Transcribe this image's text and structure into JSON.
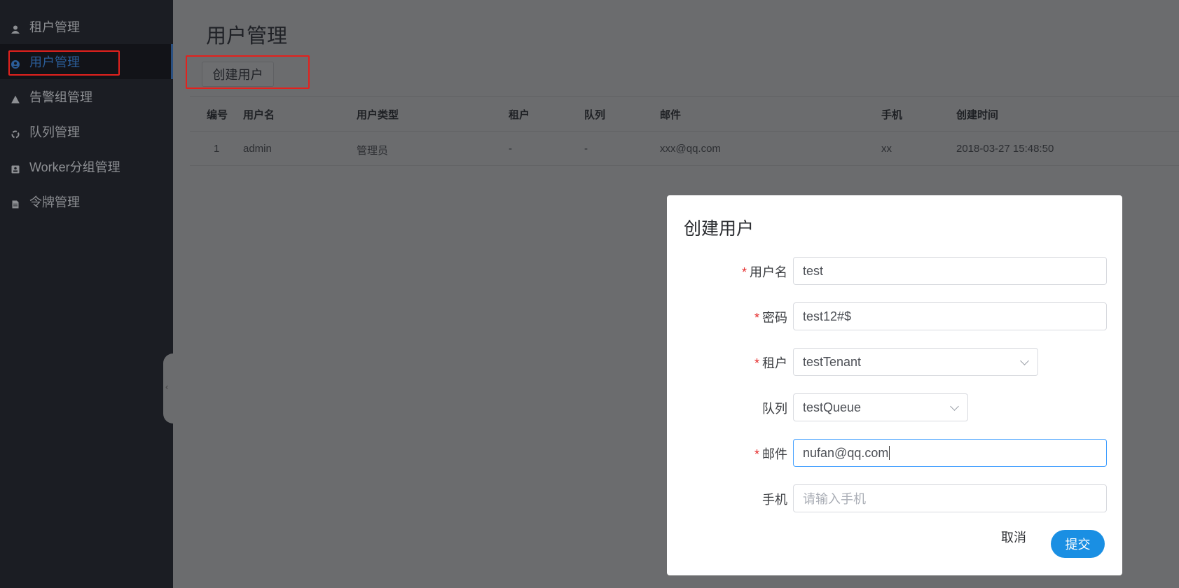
{
  "sidebar": {
    "items": [
      {
        "label": "租户管理",
        "icon": "user-icon"
      },
      {
        "label": "用户管理",
        "icon": "user-circle-icon",
        "active": true
      },
      {
        "label": "告警组管理",
        "icon": "warning-icon"
      },
      {
        "label": "队列管理",
        "icon": "recycle-icon"
      },
      {
        "label": "Worker分组管理",
        "icon": "id-card-icon"
      },
      {
        "label": "令牌管理",
        "icon": "document-icon"
      }
    ]
  },
  "main": {
    "title": "用户管理",
    "create_button": "创建用户",
    "table": {
      "headers": [
        "编号",
        "用户名",
        "用户类型",
        "租户",
        "队列",
        "邮件",
        "手机",
        "创建时间"
      ],
      "rows": [
        [
          "1",
          "admin",
          "管理员",
          "-",
          "-",
          "xxx@qq.com",
          "xx",
          "2018-03-27 15:48:50"
        ]
      ]
    }
  },
  "modal": {
    "title": "创建用户",
    "fields": {
      "username": {
        "label": "用户名",
        "value": "test",
        "required": true
      },
      "password": {
        "label": "密码",
        "value": "test12#$",
        "required": true
      },
      "tenant": {
        "label": "租户",
        "value": "testTenant",
        "required": true
      },
      "queue": {
        "label": "队列",
        "value": "testQueue",
        "required": false
      },
      "email": {
        "label": "邮件",
        "value": "nufan@qq.com",
        "required": true
      },
      "phone": {
        "label": "手机",
        "placeholder": "请输入手机",
        "required": false
      }
    },
    "required_mark": "*",
    "cancel": "取消",
    "submit": "提交"
  },
  "colors": {
    "accent": "#1a8fe3",
    "sidebar_bg": "#1b1d23",
    "highlight_box": "#e3211d",
    "required": "#e52b2b"
  }
}
